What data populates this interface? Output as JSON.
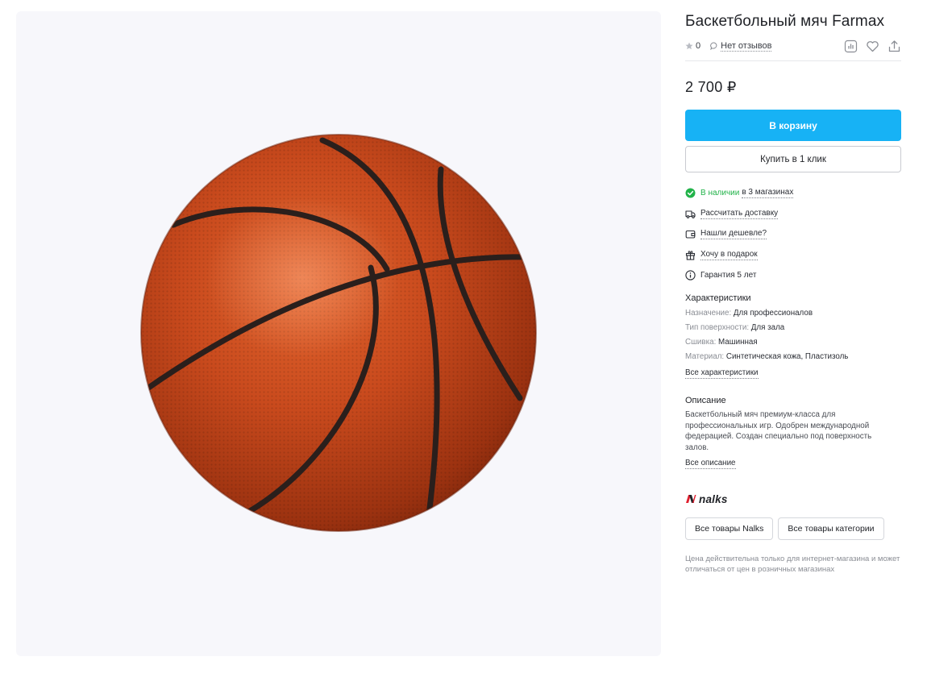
{
  "product": {
    "title": "Баскетбольный мяч Farmax",
    "rating_value": "0",
    "reviews_label": "Нет отзывов",
    "price": "2 700 ₽"
  },
  "actions": {
    "compare_icon": "chart-bars-icon",
    "favorite_icon": "heart-icon",
    "share_icon": "share-icon"
  },
  "buy": {
    "cart_label": "В корзину",
    "one_click_label": "Купить в 1 клик"
  },
  "availability": {
    "status": "В наличии",
    "stores": "в 3 магазинах",
    "status_color": "#22b34a"
  },
  "info": {
    "delivery": "Рассчитать доставку",
    "cheaper": "Нашли дешевле?",
    "gift": "Хочу в подарок",
    "warranty": "Гарантия 5 лет"
  },
  "specs": {
    "title": "Характеристики",
    "rows": [
      {
        "key": "Назначение",
        "value": "Для профессионалов"
      },
      {
        "key": "Тип поверхности",
        "value": "Для зала"
      },
      {
        "key": "Сшивка",
        "value": "Машинная"
      },
      {
        "key": "Материал",
        "value": "Синтетическая кожа, Пластизоль"
      }
    ],
    "all_link": "Все характеристики"
  },
  "description": {
    "title": "Описание",
    "text": "Баскетбольный мяч премиум-класса для профессиональных игр. Одобрен международной федерацией. Создан специально под поверхность залов.",
    "all_link": "Все описание"
  },
  "brand": {
    "logo_text": "nalks",
    "all_brand_button": "Все товары Nalks",
    "all_category_button": "Все товары категории"
  },
  "note": "Цена действительна только для интернет-магазина и может отличаться от цен в розничных магазинах",
  "colors": {
    "accent": "#17b2f5",
    "gallery_bg": "#f7f7fb",
    "ball": "#c8481c"
  }
}
